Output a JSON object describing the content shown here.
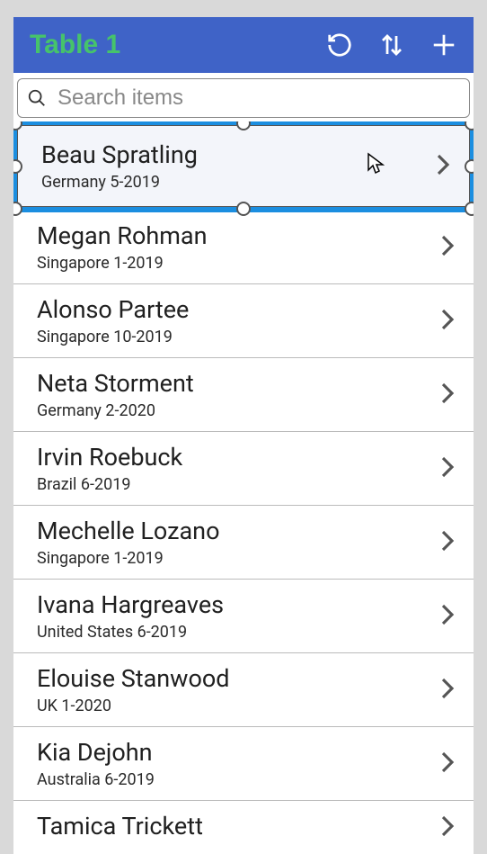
{
  "header": {
    "title": "Table 1"
  },
  "search": {
    "placeholder": "Search items"
  },
  "list": {
    "items": [
      {
        "name": "Beau Spratling",
        "subtitle": "Germany 5-2019",
        "selected": true
      },
      {
        "name": "Megan Rohman",
        "subtitle": "Singapore 1-2019",
        "selected": false
      },
      {
        "name": "Alonso Partee",
        "subtitle": "Singapore 10-2019",
        "selected": false
      },
      {
        "name": "Neta Storment",
        "subtitle": "Germany 2-2020",
        "selected": false
      },
      {
        "name": "Irvin Roebuck",
        "subtitle": "Brazil 6-2019",
        "selected": false
      },
      {
        "name": "Mechelle Lozano",
        "subtitle": "Singapore 1-2019",
        "selected": false
      },
      {
        "name": "Ivana Hargreaves",
        "subtitle": "United States 6-2019",
        "selected": false
      },
      {
        "name": "Elouise Stanwood",
        "subtitle": "UK 1-2020",
        "selected": false
      },
      {
        "name": "Kia Dejohn",
        "subtitle": "Australia 6-2019",
        "selected": false
      }
    ],
    "partial": {
      "name": "Tamica Trickett"
    }
  }
}
